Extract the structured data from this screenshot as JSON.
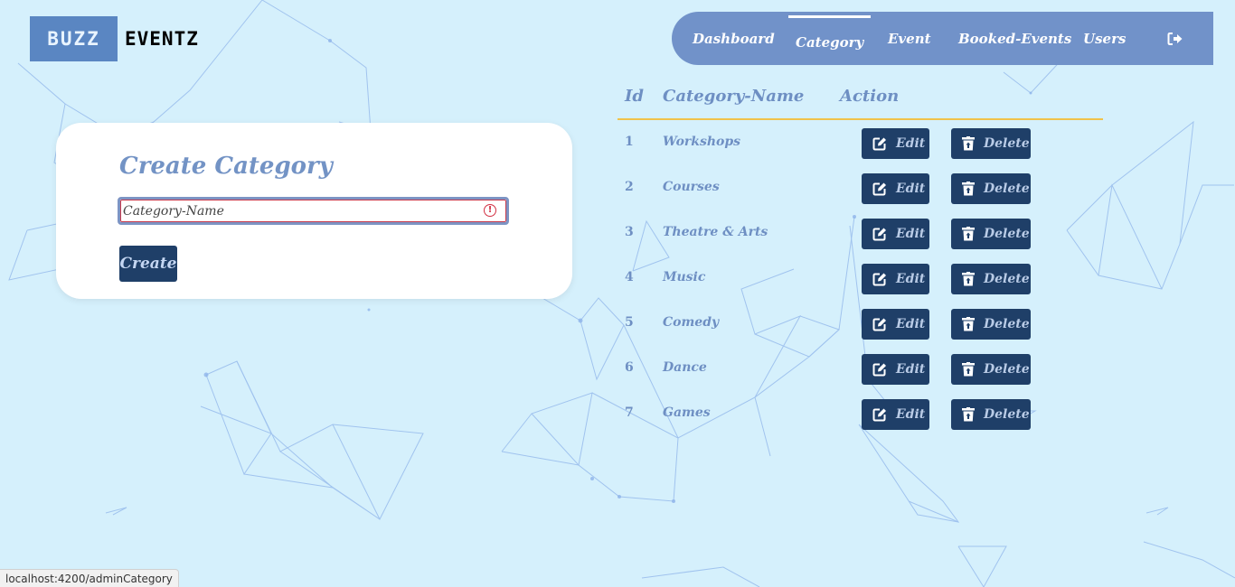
{
  "brand": {
    "part1": "BUZZ",
    "part2": "EVENTZ"
  },
  "nav": {
    "items": [
      {
        "label": "Dashboard"
      },
      {
        "label": "Category"
      },
      {
        "label": "Event"
      },
      {
        "label": "Booked-Events"
      },
      {
        "label": "Users"
      }
    ],
    "active": "Category",
    "logout_icon": "sign-out-icon"
  },
  "form": {
    "title": "Create Category",
    "input_placeholder": "Category-Name",
    "input_value": "",
    "error_icon": "exclamation-circle-icon",
    "submit_label": "Create"
  },
  "table": {
    "headers": [
      "Id",
      "Category-Name",
      "Action"
    ],
    "edit_label": "Edit",
    "delete_label": "Delete",
    "edit_icon": "edit-icon",
    "delete_icon": "trash-icon",
    "rows": [
      {
        "id": "1",
        "name": "Workshops"
      },
      {
        "id": "2",
        "name": "Courses"
      },
      {
        "id": "3",
        "name": "Theatre & Arts"
      },
      {
        "id": "4",
        "name": "Music"
      },
      {
        "id": "5",
        "name": "Comedy"
      },
      {
        "id": "6",
        "name": "Dance"
      },
      {
        "id": "7",
        "name": "Games"
      }
    ]
  },
  "status_bar": {
    "url": "localhost:4200/adminCategory"
  },
  "colors": {
    "background": "#d5f0fc",
    "navbar": "#7192c9",
    "button": "#1f3f68",
    "accent_line": "#f0c24b",
    "text_accent": "#6e8fc3",
    "error": "#d23043"
  }
}
